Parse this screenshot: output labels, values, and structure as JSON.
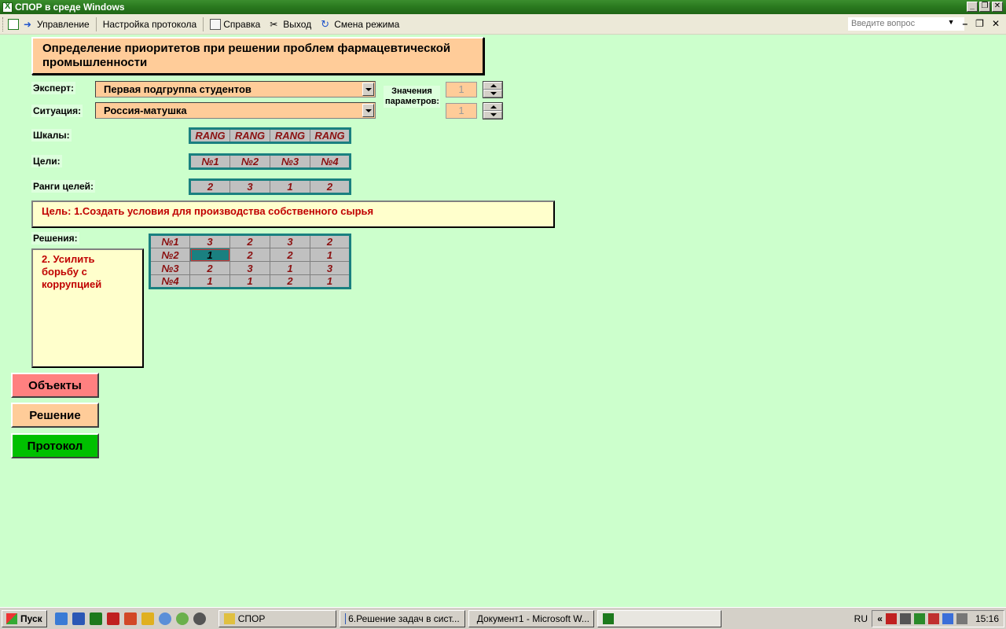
{
  "window": {
    "title": "СПОР в среде Windows"
  },
  "menu": {
    "items": [
      "Управление",
      "Настройка протокола",
      "Справка",
      "Выход",
      "Смена режима"
    ],
    "ask_placeholder": "Введите вопрос"
  },
  "form": {
    "heading": "Определение приоритетов при решении проблем фармацевтической промышленности",
    "expert_label": "Эксперт:",
    "expert_value": "Первая подгруппа студентов",
    "situation_label": "Ситуация:",
    "situation_value": "Россия-матушка",
    "params_label": "Значения параметров:",
    "param1_value": "1",
    "param2_value": "1",
    "scales_label": "Шкалы:",
    "goals_label": "Цели:",
    "goal_ranks_label": "Ранги целей:",
    "decisions_label": "Решения:",
    "scales": [
      "RANG",
      "RANG",
      "RANG",
      "RANG"
    ],
    "goals": [
      "№1",
      "№2",
      "№3",
      "№4"
    ],
    "goal_ranks": [
      "2",
      "3",
      "1",
      "2"
    ],
    "goal_text": "Цель: 1.Создать условия для производства собственного сырья",
    "decision_text": "2. Усилить борьбу с коррупцией",
    "decisions_matrix": [
      {
        "row": "№1",
        "values": [
          "3",
          "2",
          "3",
          "2"
        ]
      },
      {
        "row": "№2",
        "values": [
          "1",
          "2",
          "2",
          "1"
        ]
      },
      {
        "row": "№3",
        "values": [
          "2",
          "3",
          "1",
          "3"
        ]
      },
      {
        "row": "№4",
        "values": [
          "1",
          "1",
          "2",
          "1"
        ]
      }
    ],
    "selected_cell": "№2 / col 1"
  },
  "buttons": {
    "objects": "Объекты",
    "decision": "Решение",
    "protocol": "Протокол",
    "colors": {
      "objects": "#ff8080",
      "decision": "#ffcc99",
      "protocol": "#00c000"
    }
  },
  "taskbar": {
    "start": "Пуск",
    "tasks": [
      "СПОР",
      "6.Решение задач в сист...",
      "Документ1 - Microsoft W..."
    ],
    "lang": "RU",
    "clock": "15:16"
  }
}
